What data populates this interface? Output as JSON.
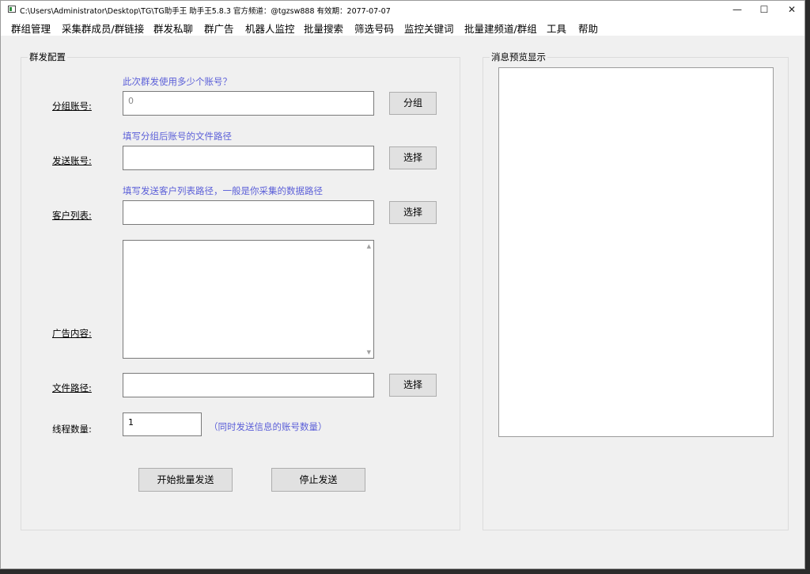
{
  "window": {
    "title": "C:\\Users\\Administrator\\Desktop\\TG\\TG助手王  助手王5.8.3  官方频道：@tgzsw888     有效期：2077-07-07",
    "minimize_glyph": "—",
    "maximize_glyph": "☐",
    "close_glyph": "✕"
  },
  "menu": [
    "群组管理",
    "采集群成员/群链接",
    "群发私聊",
    "群广告",
    "机器人监控",
    "批量搜索",
    "筛选号码",
    "监控关键词",
    "批量建频道/群组",
    "工具",
    "帮助"
  ],
  "config": {
    "title": "群发配置",
    "group_hint": "此次群发使用多少个账号？",
    "group_label": "分组账号:",
    "group_value": "0",
    "group_button": "分组",
    "send_hint": "填写分组后账号的文件路径",
    "send_label": "发送账号:",
    "send_button": "选择",
    "customer_hint": "填写发送客户列表路径，一般是你采集的数据路径",
    "customer_label": "客户列表:",
    "customer_button": "选择",
    "ad_label": "广告内容:",
    "file_label": "文件路径:",
    "file_button": "选择",
    "thread_label": "线程数量:",
    "thread_value": "1",
    "thread_hint": "（同时发送信息的账号数量）",
    "start_button": "开始批量发送",
    "stop_button": "停止发送"
  },
  "preview": {
    "title": "消息预览显示"
  },
  "icons": {
    "app": "app-icon",
    "scroll_up": "▲",
    "scroll_down": "▼"
  }
}
